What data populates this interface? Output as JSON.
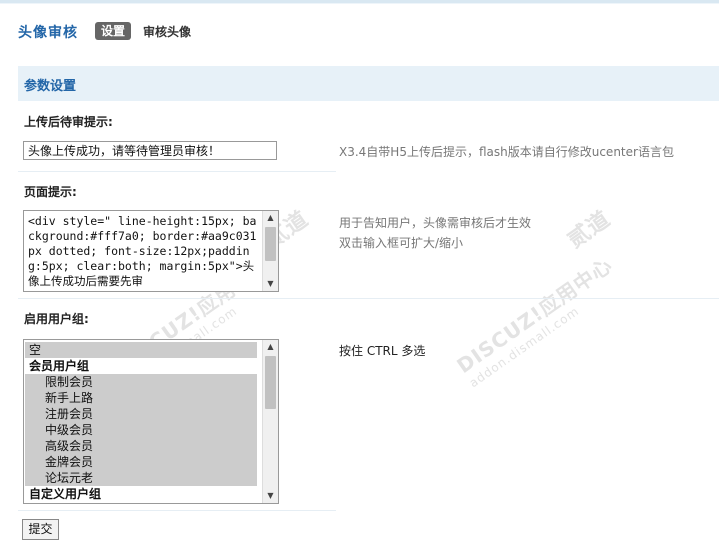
{
  "header": {
    "title": "头像审核",
    "tabs": [
      {
        "label": "设置",
        "active": true
      },
      {
        "label": "审核头像",
        "active": false
      }
    ]
  },
  "section": {
    "title": "参数设置"
  },
  "fields": {
    "upload_prompt": {
      "label": "上传后待审提示:",
      "value": "头像上传成功，请等待管理员审核！",
      "hint": "X3.4自带H5上传后提示，flash版本请自行修改ucenter语言包"
    },
    "page_prompt": {
      "label": "页面提示:",
      "value": "<div style=\" line-height:15px; background:#fff7a0; border:#aa9c031px dotted; font-size:12px;padding:5px; clear:both; margin:5px\">头像上传成功后需要先审",
      "hint_line1": "用于告知用户，头像需审核后才生效",
      "hint_line2": "双击输入框可扩大/缩小"
    },
    "user_groups": {
      "label": "启用用户组:",
      "hint": "按住 CTRL 多选",
      "options": [
        {
          "label": "空",
          "selected": true,
          "group": false,
          "indent": false
        },
        {
          "label": "会员用户组",
          "selected": false,
          "group": true,
          "indent": false
        },
        {
          "label": "限制会员",
          "selected": true,
          "group": false,
          "indent": true
        },
        {
          "label": "新手上路",
          "selected": true,
          "group": false,
          "indent": true
        },
        {
          "label": "注册会员",
          "selected": true,
          "group": false,
          "indent": true
        },
        {
          "label": "中级会员",
          "selected": true,
          "group": false,
          "indent": true
        },
        {
          "label": "高级会员",
          "selected": true,
          "group": false,
          "indent": true
        },
        {
          "label": "金牌会员",
          "selected": true,
          "group": false,
          "indent": true
        },
        {
          "label": "论坛元老",
          "selected": true,
          "group": false,
          "indent": true
        },
        {
          "label": "自定义用户组",
          "selected": false,
          "group": true,
          "indent": false
        }
      ]
    }
  },
  "submit_label": "提交",
  "watermark": {
    "brand": "DISCUZ!应用中心",
    "url": "addon.dismall.com",
    "tag": "贰道"
  },
  "icons": {
    "scroll_up": "scroll-up-arrow-icon",
    "scroll_down": "scroll-down-arrow-icon"
  }
}
